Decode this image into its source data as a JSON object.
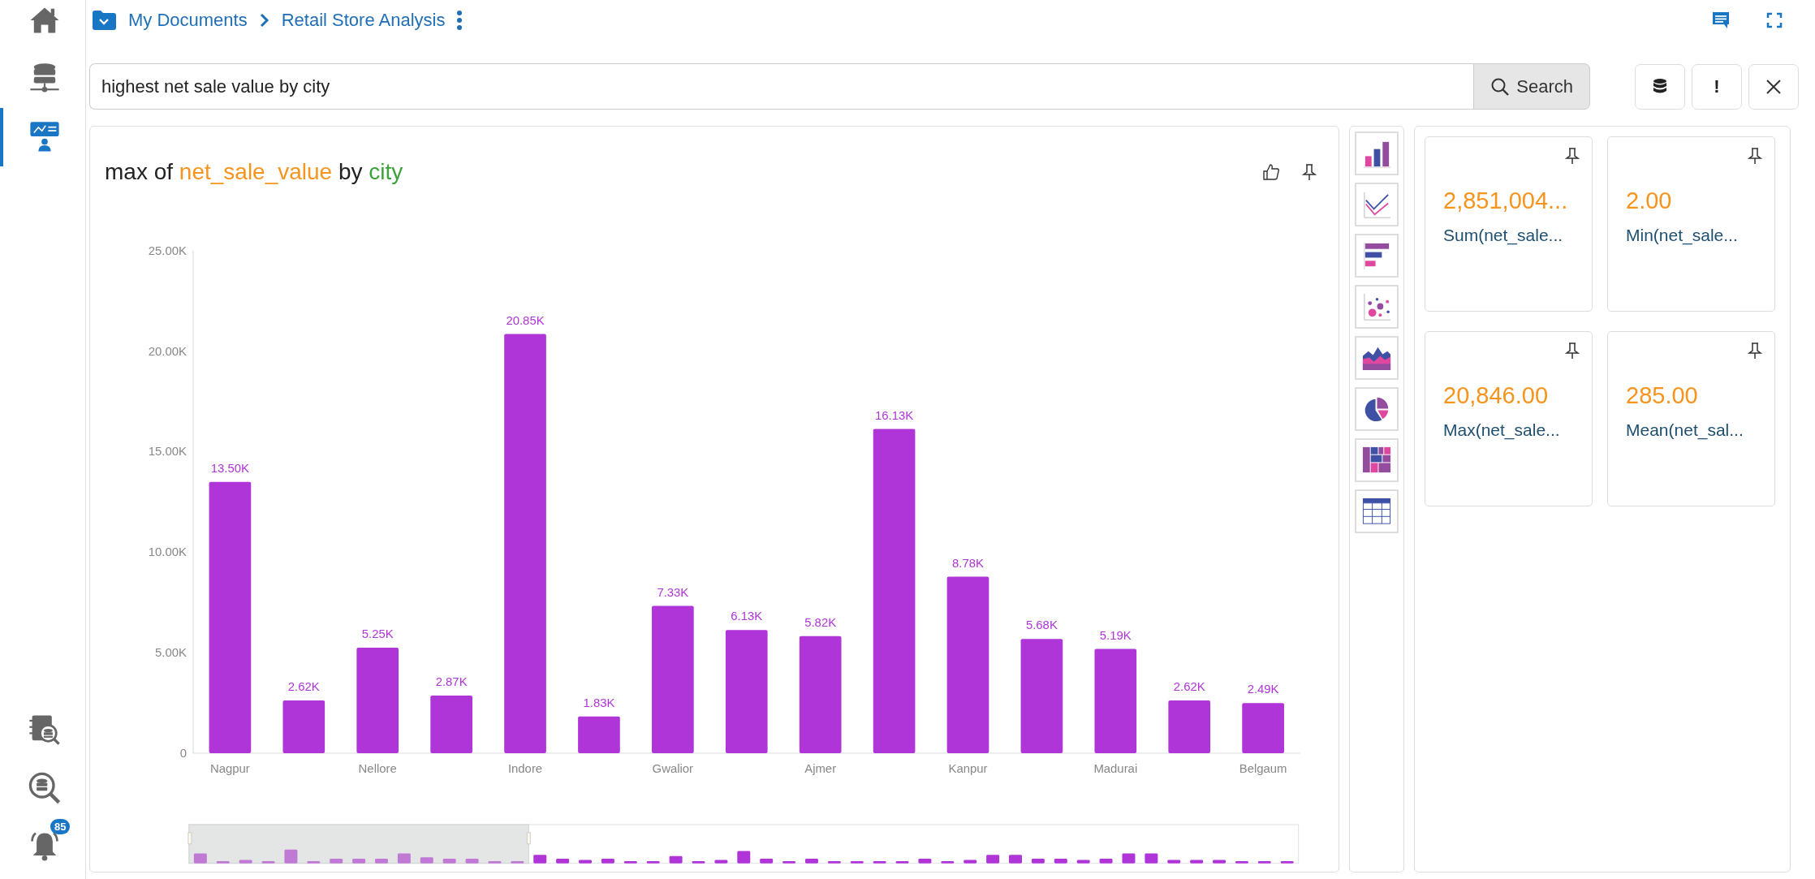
{
  "sidebar": {
    "items": [
      {
        "kind": "home",
        "selected": false
      },
      {
        "kind": "data-sources",
        "selected": false
      },
      {
        "kind": "analytics",
        "selected": true
      }
    ],
    "bottom_items": [
      {
        "kind": "reports",
        "selected": false
      },
      {
        "kind": "search-data",
        "selected": false
      },
      {
        "kind": "notifications",
        "selected": false,
        "badge": "85"
      }
    ]
  },
  "breadcrumb": {
    "items": [
      "My Documents",
      "Retail Store Analysis"
    ]
  },
  "search": {
    "value": "highest net sale value by city",
    "button": "Search"
  },
  "tool_buttons": [
    {
      "kind": "database"
    },
    {
      "kind": "info",
      "label": "!"
    },
    {
      "kind": "close"
    }
  ],
  "chart_panel": {
    "title": [
      {
        "text": "max of",
        "kind": "plain"
      },
      {
        "text": "net_sale_value",
        "kind": "measure"
      },
      {
        "text": "by",
        "kind": "plain"
      },
      {
        "text": "city",
        "kind": "dimension"
      }
    ],
    "chart_data": {
      "type": "bar",
      "categories": [
        "Nagpur",
        null,
        "Nellore",
        null,
        "Indore",
        null,
        "Gwalior",
        null,
        "Ajmer",
        null,
        "Kanpur",
        null,
        "Madurai",
        null,
        "Belgaum"
      ],
      "series": [
        {
          "color": "#b035d8",
          "values": [
            13500,
            2620,
            5250,
            2870,
            20850,
            1830,
            7330,
            6130,
            5820,
            16130,
            8780,
            5680,
            5190,
            2620,
            2490
          ]
        }
      ],
      "ylim": [
        0,
        25000
      ],
      "yticks": [
        {
          "value": 0,
          "label": "0"
        },
        {
          "value": 5000,
          "label": "5.00K"
        },
        {
          "value": 10000,
          "label": "10.00K"
        },
        {
          "value": 15000,
          "label": "15.00K"
        },
        {
          "value": 20000,
          "label": "20.00K"
        },
        {
          "value": 25000,
          "label": "25.00K"
        }
      ],
      "value_labels": [
        "13.50K",
        "2.62K",
        "5.25K",
        "2.87K",
        "20.85K",
        "1.83K",
        "7.33K",
        "6.13K",
        "5.82K",
        "16.13K",
        "8.78K",
        "5.68K",
        "5.19K",
        "2.62K",
        "2.49K"
      ]
    }
  },
  "chart_types": [
    {
      "kind": "bar"
    },
    {
      "kind": "line"
    },
    {
      "kind": "hbar"
    },
    {
      "kind": "scatter"
    },
    {
      "kind": "area"
    },
    {
      "kind": "pie"
    },
    {
      "kind": "treemap"
    },
    {
      "kind": "table"
    }
  ],
  "kpis": [
    {
      "value": "2,851,004...",
      "label": "Sum(net_sale..."
    },
    {
      "value": "2.00",
      "label": "Min(net_sale..."
    },
    {
      "value": "20,846.00",
      "label": "Max(net_sale..."
    },
    {
      "value": "285.00",
      "label": "Mean(net_sal..."
    }
  ]
}
